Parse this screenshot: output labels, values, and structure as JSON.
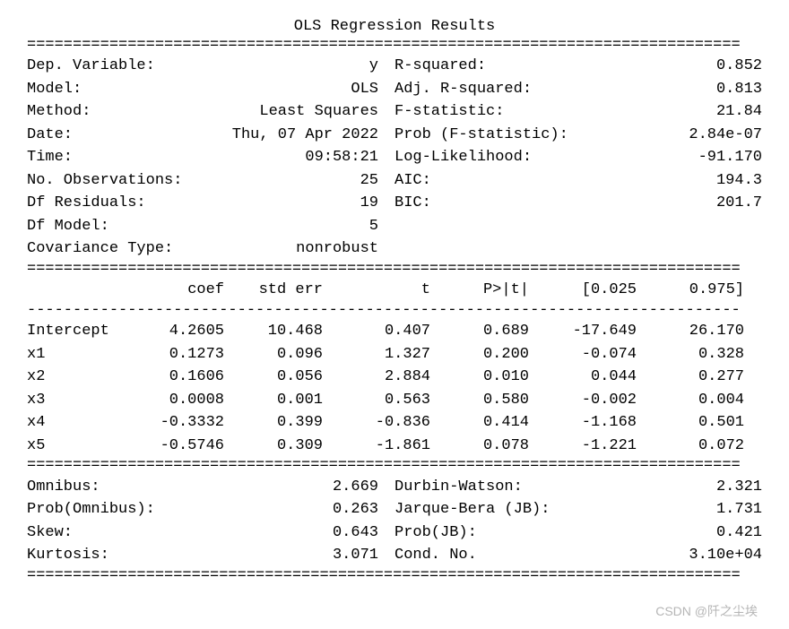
{
  "title": "OLS Regression Results",
  "divider": "==============================================================================",
  "divider_thin": "------------------------------------------------------------------------------",
  "summary_top_left": [
    {
      "label": "Dep. Variable:",
      "value": "y"
    },
    {
      "label": "Model:",
      "value": "OLS"
    },
    {
      "label": "Method:",
      "value": "Least Squares"
    },
    {
      "label": "Date:",
      "value": "Thu, 07 Apr 2022"
    },
    {
      "label": "Time:",
      "value": "09:58:21"
    },
    {
      "label": "No. Observations:",
      "value": "25"
    },
    {
      "label": "Df Residuals:",
      "value": "19"
    },
    {
      "label": "Df Model:",
      "value": "5"
    },
    {
      "label": "Covariance Type:",
      "value": "nonrobust"
    }
  ],
  "summary_top_right": [
    {
      "label": "R-squared:",
      "value": "0.852"
    },
    {
      "label": "Adj. R-squared:",
      "value": "0.813"
    },
    {
      "label": "F-statistic:",
      "value": "21.84"
    },
    {
      "label": "Prob (F-statistic):",
      "value": "2.84e-07"
    },
    {
      "label": "Log-Likelihood:",
      "value": "-91.170"
    },
    {
      "label": "AIC:",
      "value": "194.3"
    },
    {
      "label": "BIC:",
      "value": "201.7"
    },
    {
      "label": "",
      "value": ""
    },
    {
      "label": "",
      "value": ""
    }
  ],
  "coef_headers": {
    "name": "",
    "coef": "coef",
    "stderr": "std err",
    "t": "t",
    "p": "P>|t|",
    "lo": "[0.025",
    "hi": "0.975]"
  },
  "coef_rows": [
    {
      "name": "Intercept",
      "coef": "4.2605",
      "stderr": "10.468",
      "t": "0.407",
      "p": "0.689",
      "lo": "-17.649",
      "hi": "26.170"
    },
    {
      "name": "x1",
      "coef": "0.1273",
      "stderr": "0.096",
      "t": "1.327",
      "p": "0.200",
      "lo": "-0.074",
      "hi": "0.328"
    },
    {
      "name": "x2",
      "coef": "0.1606",
      "stderr": "0.056",
      "t": "2.884",
      "p": "0.010",
      "lo": "0.044",
      "hi": "0.277"
    },
    {
      "name": "x3",
      "coef": "0.0008",
      "stderr": "0.001",
      "t": "0.563",
      "p": "0.580",
      "lo": "-0.002",
      "hi": "0.004"
    },
    {
      "name": "x4",
      "coef": "-0.3332",
      "stderr": "0.399",
      "t": "-0.836",
      "p": "0.414",
      "lo": "-1.168",
      "hi": "0.501"
    },
    {
      "name": "x5",
      "coef": "-0.5746",
      "stderr": "0.309",
      "t": "-1.861",
      "p": "0.078",
      "lo": "-1.221",
      "hi": "0.072"
    }
  ],
  "summary_bottom_left": [
    {
      "label": "Omnibus:",
      "value": "2.669"
    },
    {
      "label": "Prob(Omnibus):",
      "value": "0.263"
    },
    {
      "label": "Skew:",
      "value": "0.643"
    },
    {
      "label": "Kurtosis:",
      "value": "3.071"
    }
  ],
  "summary_bottom_right": [
    {
      "label": "Durbin-Watson:",
      "value": "2.321"
    },
    {
      "label": "Jarque-Bera (JB):",
      "value": "1.731"
    },
    {
      "label": "Prob(JB):",
      "value": "0.421"
    },
    {
      "label": "Cond. No.",
      "value": "3.10e+04"
    }
  ],
  "watermark": "CSDN @阡之尘埃"
}
